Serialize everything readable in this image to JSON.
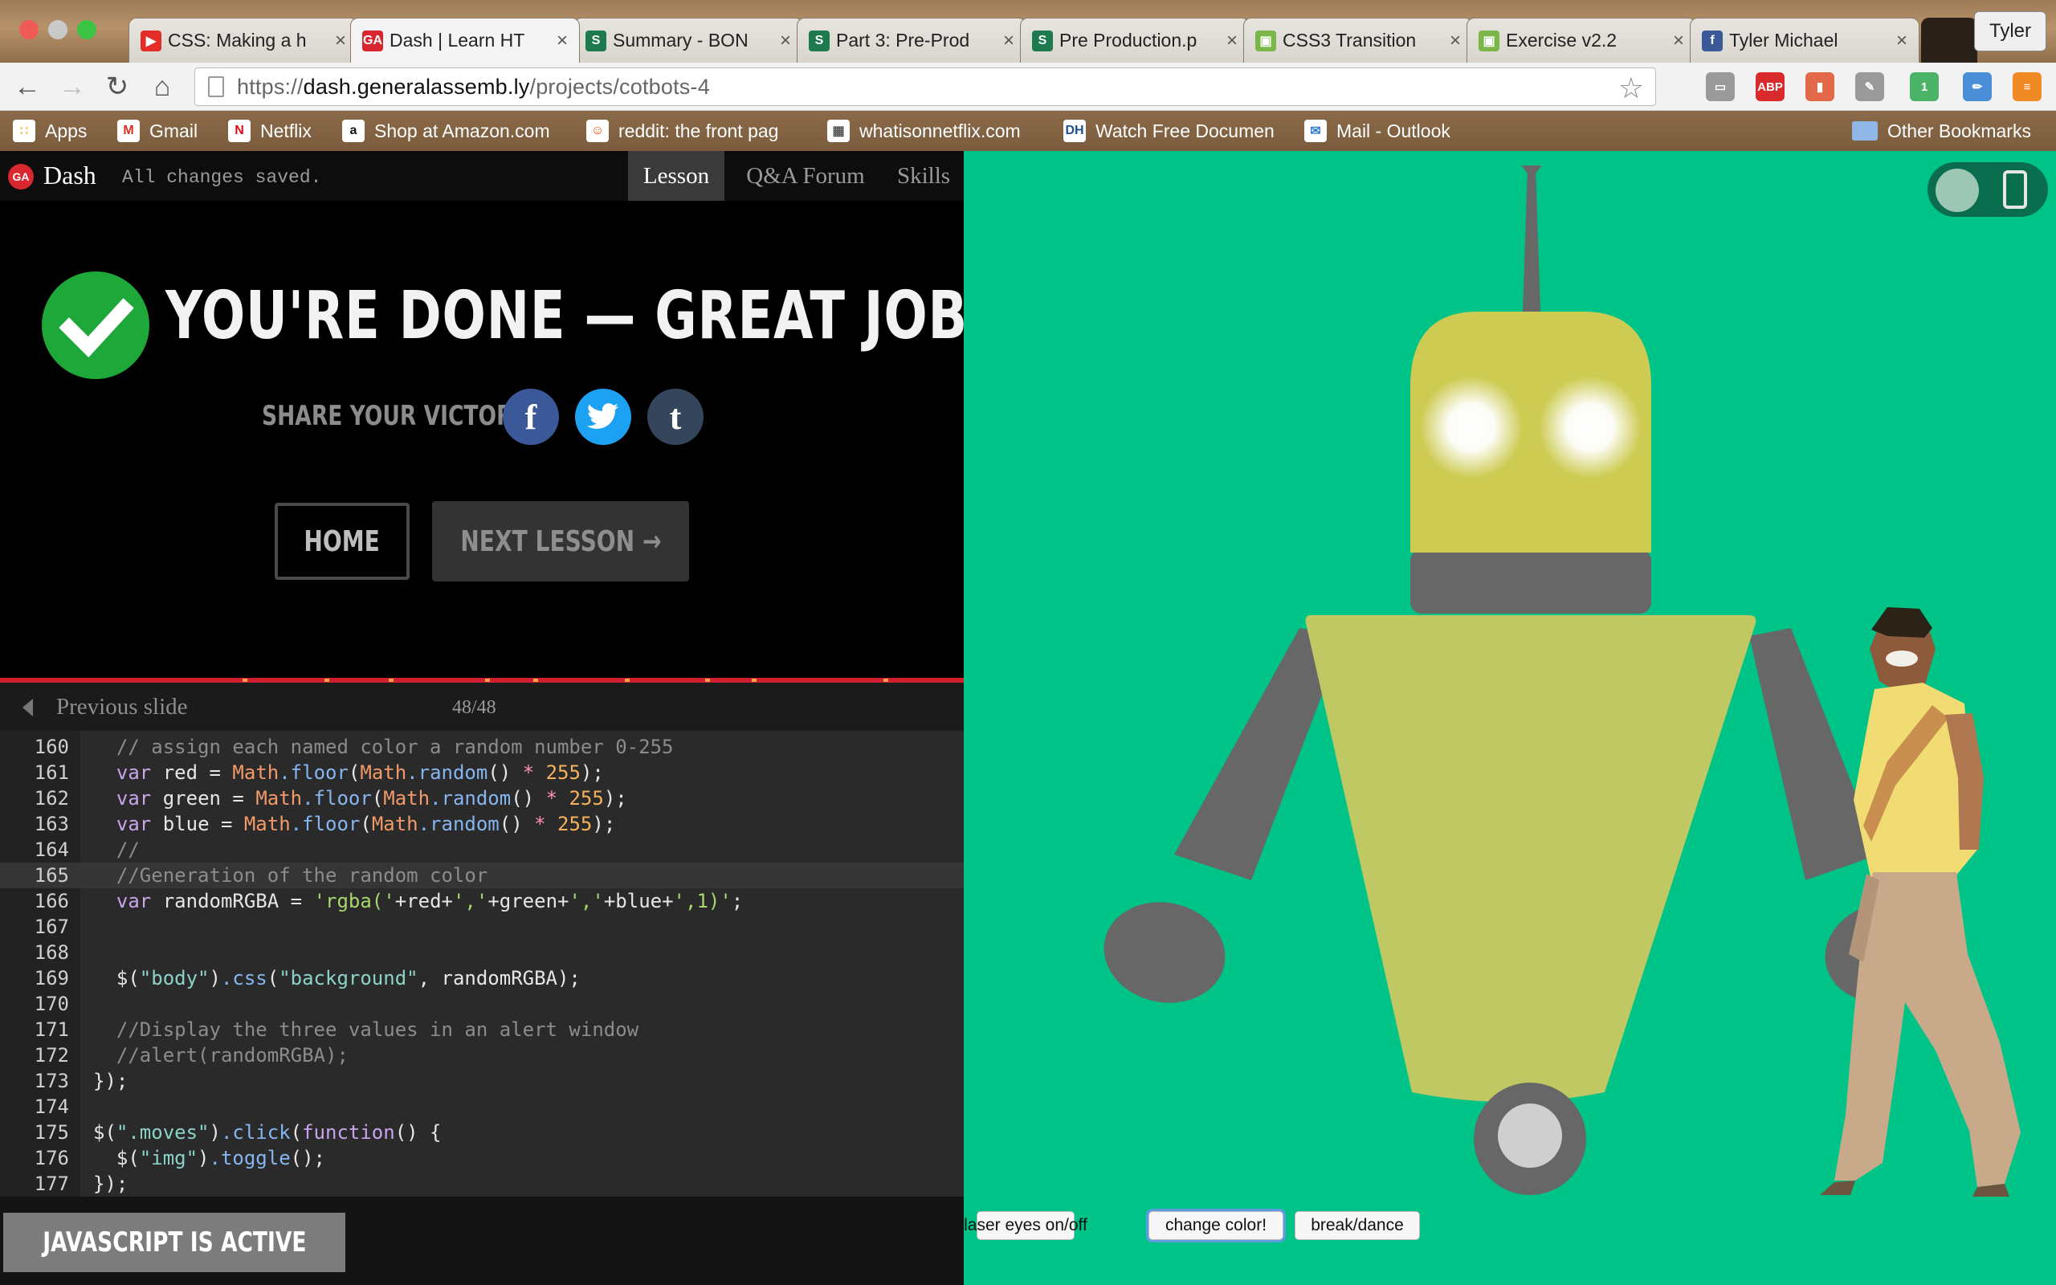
{
  "browser": {
    "tabs": [
      {
        "title": "CSS: Making a h",
        "icon_text": "▶",
        "icon_color": "#e52d27"
      },
      {
        "title": "Dash | Learn HT",
        "icon_text": "GA",
        "icon_color": "#d8272e"
      },
      {
        "title": "Summary - BON",
        "icon_text": "S",
        "icon_color": "#1d7a4e"
      },
      {
        "title": "Part 3: Pre-Prod",
        "icon_text": "S",
        "icon_color": "#1d7a4e"
      },
      {
        "title": "Pre Production.p",
        "icon_text": "S",
        "icon_color": "#1d7a4e"
      },
      {
        "title": "CSS3 Transition",
        "icon_text": "▣",
        "icon_color": "#7ab648"
      },
      {
        "title": "Exercise v2.2",
        "icon_text": "▣",
        "icon_color": "#7ab648"
      },
      {
        "title": "Tyler Michael",
        "icon_text": "f",
        "icon_color": "#3b5998"
      }
    ],
    "tab_close": "×",
    "profile_name": "Tyler",
    "url": {
      "scheme": "https://",
      "host": "dash.generalassemb.ly",
      "path": "/projects/cotbots-4"
    },
    "icons": {
      "back": "←",
      "forward": "→",
      "reload": "↻",
      "home": "⌂",
      "star": "☆"
    },
    "extensions": [
      {
        "name": "cast-icon",
        "label": "▭",
        "color": "#9a9a9a"
      },
      {
        "name": "adblock-plus-icon",
        "label": "ABP",
        "color": "#d82a2a"
      },
      {
        "name": "bookmark-extension-icon",
        "label": "▮",
        "color": "#e26a4a"
      },
      {
        "name": "pen-extension-icon",
        "label": "✎",
        "color": "#9a9a9a"
      },
      {
        "name": "pushbullet-icon",
        "label": "1",
        "color": "#4ab367"
      },
      {
        "name": "eyedropper-icon",
        "label": "✏",
        "color": "#4a8ed8"
      },
      {
        "name": "menu-icon",
        "label": "≡",
        "color": "#f08a24"
      }
    ],
    "bookmarks": [
      {
        "label": "Apps",
        "icon": "∷",
        "color": "#f0c040"
      },
      {
        "label": "Gmail",
        "icon": "M",
        "color": "#d93025"
      },
      {
        "label": "Netflix",
        "icon": "N",
        "color": "#e50914"
      },
      {
        "label": "Shop at Amazon.com",
        "icon": "a",
        "color": "#111111"
      },
      {
        "label": "reddit: the front pag",
        "icon": "☺",
        "color": "#ff4500"
      },
      {
        "label": "whatisonnetflix.com",
        "icon": "▦",
        "color": "#555555"
      },
      {
        "label": "Watch Free Documen",
        "icon": "DH",
        "color": "#1f4f8f"
      },
      {
        "label": "Mail - Outlook",
        "icon": "✉",
        "color": "#2f7cd0"
      }
    ],
    "other_bookmarks": "Other Bookmarks"
  },
  "dash": {
    "logo": "GA",
    "title": "Dash",
    "saved_status": "All changes saved.",
    "nav": [
      "Lesson",
      "Q&A Forum",
      "Skills"
    ],
    "done_title": "YOU'RE DONE — GREAT JOB!",
    "share_label": "SHARE YOUR VICTORY:",
    "social": [
      {
        "label": "f",
        "color": "#3b5998"
      },
      {
        "label": "t",
        "color": "#1da1f2"
      },
      {
        "label": "t",
        "color": "#35465c"
      }
    ],
    "home_button": "HOME",
    "next_button": "NEXT LESSON →",
    "prev_slide": "Previous slide",
    "slide_count": "48/48",
    "js_status": "JAVASCRIPT IS ACTIVE"
  },
  "code": {
    "current_line": 165,
    "lines": [
      {
        "n": "160",
        "text": "  // assign each named color a random number 0-255"
      },
      {
        "n": "161",
        "text": "  var red = Math.floor(Math.random() * 255);"
      },
      {
        "n": "162",
        "text": "  var green = Math.floor(Math.random() * 255);"
      },
      {
        "n": "163",
        "text": "  var blue = Math.floor(Math.random() * 255);"
      },
      {
        "n": "164",
        "text": "  //"
      },
      {
        "n": "165",
        "text": "  //Generation of the random color"
      },
      {
        "n": "166",
        "text": "  var randomRGBA = 'rgba('+red+','+green+','+blue+',1)';"
      },
      {
        "n": "167",
        "text": ""
      },
      {
        "n": "168",
        "text": ""
      },
      {
        "n": "169",
        "text": "  $(\"body\").css(\"background\", randomRGBA);"
      },
      {
        "n": "170",
        "text": ""
      },
      {
        "n": "171",
        "text": "  //Display the three values in an alert window"
      },
      {
        "n": "172",
        "text": "  //alert(randomRGBA);"
      },
      {
        "n": "173",
        "text": "});"
      },
      {
        "n": "174",
        "text": ""
      },
      {
        "n": "175",
        "text": "$(\".moves\").click(function() {"
      },
      {
        "n": "176",
        "text": "  $(\"img\").toggle();"
      },
      {
        "n": "177",
        "text": "});"
      }
    ]
  },
  "preview": {
    "background": "#00c487",
    "robot_colors": {
      "head": "#cdcb52",
      "body": "#bfc862",
      "metal": "#676767",
      "eye": "#ffffff"
    },
    "buttons": [
      "laser eyes on/off",
      "change color!",
      "break/dance"
    ]
  }
}
